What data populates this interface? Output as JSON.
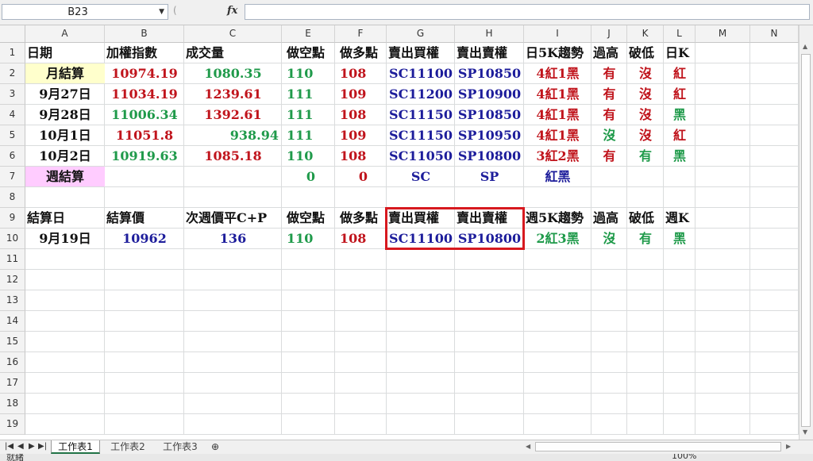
{
  "formula_bar": {
    "name_box": "B23",
    "fx": "fx",
    "formula": ""
  },
  "columns": [
    "A",
    "B",
    "C",
    "E",
    "F",
    "G",
    "H",
    "I",
    "J",
    "K",
    "L",
    "M",
    "N"
  ],
  "rows": [
    "1",
    "2",
    "3",
    "4",
    "5",
    "6",
    "7",
    "8",
    "9",
    "10",
    "11",
    "12",
    "13",
    "14",
    "15",
    "16",
    "17",
    "18",
    "19"
  ],
  "colors": {
    "red": "#c0141c",
    "green": "#1f9a4a",
    "blue": "#1d1d9b",
    "black": "#111111",
    "yellow_fill": "#ffffcc",
    "pink_fill": "#ffccff",
    "highlight": "#d7191f"
  },
  "cells": {
    "r1": [
      "日期",
      "加權指數",
      "成交量",
      "做空點",
      "做多點",
      "賣出買權",
      "賣出賣權",
      "日5K趨勢",
      "過高",
      "破低",
      "日K"
    ],
    "r2": [
      "月結算",
      "10974.19",
      "1080.35",
      "110",
      "108",
      "SC11100",
      "SP10850",
      "4紅1黑",
      "有",
      "沒",
      "紅"
    ],
    "r3": [
      "9月27日",
      "11034.19",
      "1239.61",
      "111",
      "109",
      "SC11200",
      "SP10900",
      "4紅1黑",
      "有",
      "沒",
      "紅"
    ],
    "r4": [
      "9月28日",
      "11006.34",
      "1392.61",
      "111",
      "108",
      "SC11150",
      "SP10850",
      "4紅1黑",
      "有",
      "沒",
      "黑"
    ],
    "r5": [
      "10月1日",
      "11051.8",
      "938.94",
      "111",
      "109",
      "SC11150",
      "SP10950",
      "4紅1黑",
      "沒",
      "沒",
      "紅"
    ],
    "r6": [
      "10月2日",
      "10919.63",
      "1085.18",
      "110",
      "108",
      "SC11050",
      "SP10800",
      "3紅2黑",
      "有",
      "有",
      "黑"
    ],
    "r7": [
      "週結算",
      "",
      "",
      "0",
      "0",
      "SC",
      "SP",
      "紅黑",
      "",
      "",
      ""
    ],
    "r9": [
      "結算日",
      "結算價",
      "次週價平C+P",
      "做空點",
      "做多點",
      "賣出買權",
      "賣出賣權",
      "週5K趨勢",
      "過高",
      "破低",
      "週K"
    ],
    "r10": [
      "9月19日",
      "10962",
      "136",
      "110",
      "108",
      "SC11100",
      "SP10800",
      "2紅3黑",
      "沒",
      "有",
      "黑"
    ]
  },
  "sheet_tabs": [
    "工作表1",
    "工作表2",
    "工作表3"
  ],
  "status": {
    "ready": "就緒",
    "zoom": "100%"
  }
}
